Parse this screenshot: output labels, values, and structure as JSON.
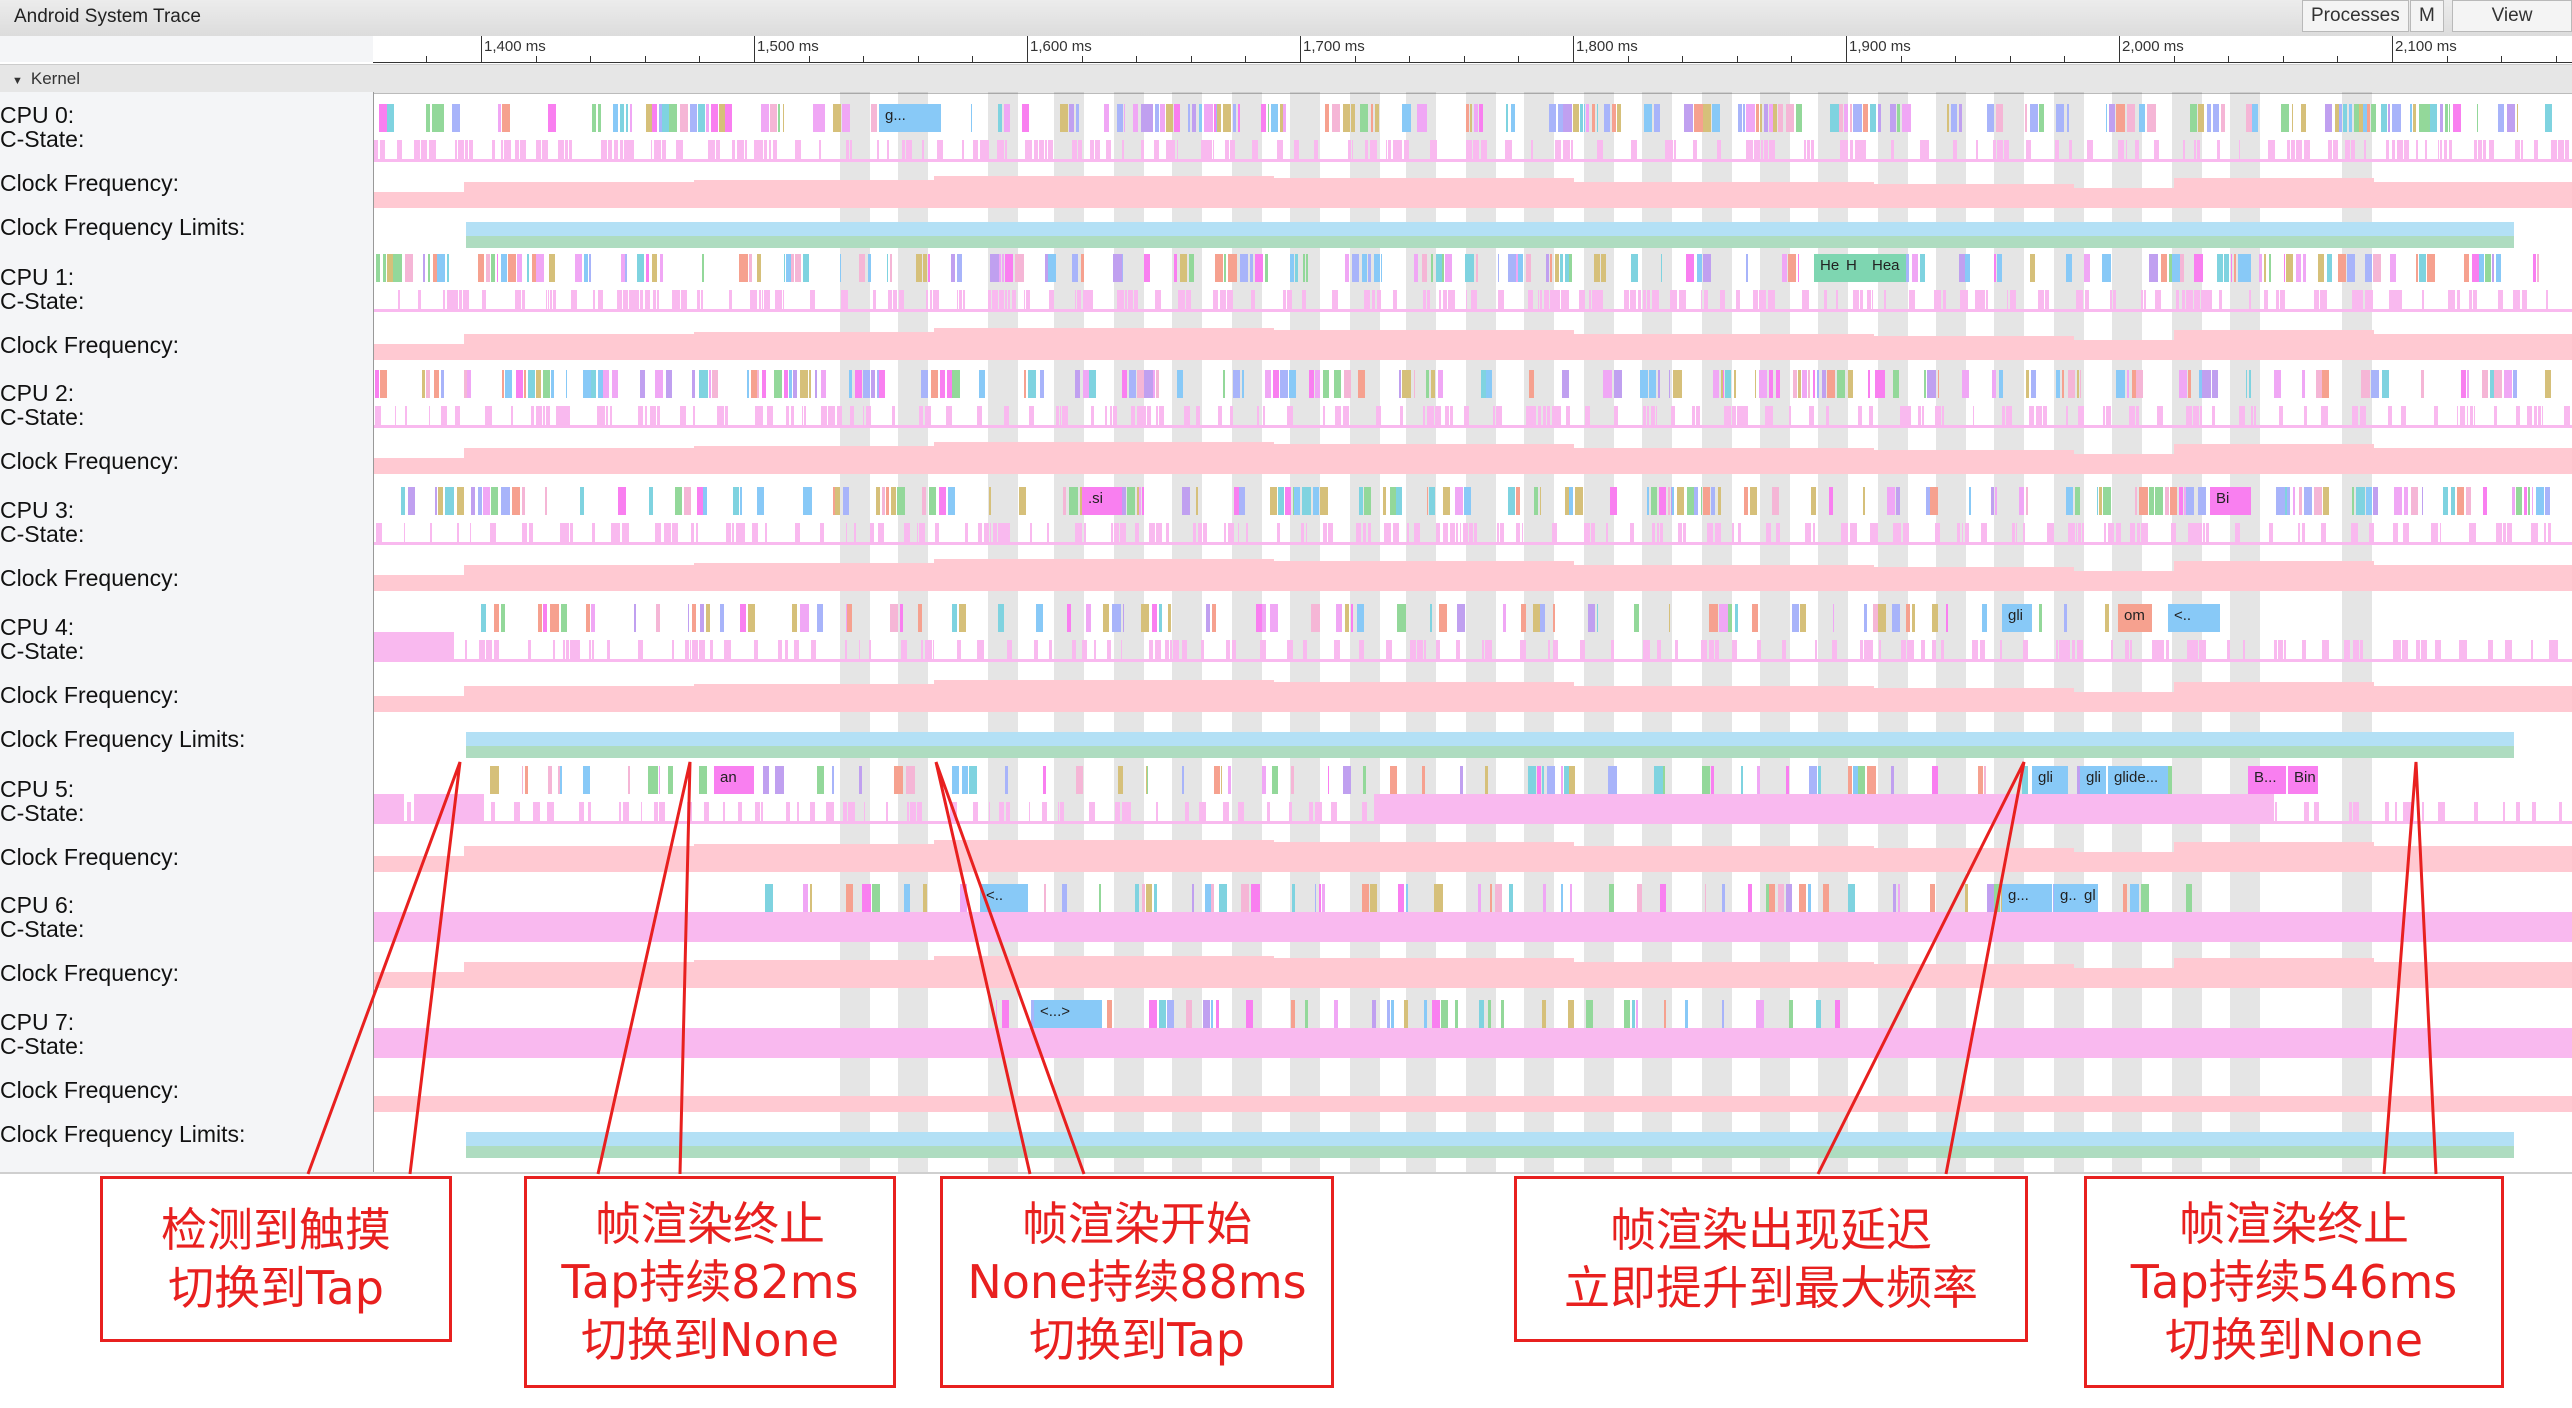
{
  "window": {
    "title": "Android System Trace",
    "buttons": [
      {
        "label": "Processes"
      },
      {
        "label": "M"
      },
      {
        "label": "View Options"
      }
    ]
  },
  "ruler": {
    "unit": "ms",
    "major_ticks": [
      "1,400 ms",
      "1,500 ms",
      "1,600 ms",
      "1,700 ms",
      "1,800 ms",
      "1,900 ms",
      "2,000 ms",
      "2,100 ms"
    ]
  },
  "group": {
    "label": "Kernel",
    "expand_icon": "triangle-down-icon"
  },
  "tracks": {
    "labels": [
      "CPU 0:",
      "C-State:",
      "Clock Frequency:",
      "Clock Frequency Limits:",
      "CPU 1:",
      "C-State:",
      "Clock Frequency:",
      "CPU 2:",
      "C-State:",
      "Clock Frequency:",
      "CPU 3:",
      "C-State:",
      "Clock Frequency:",
      "CPU 4:",
      "C-State:",
      "Clock Frequency:",
      "Clock Frequency Limits:",
      "CPU 5:",
      "C-State:",
      "Clock Frequency:",
      "CPU 6:",
      "C-State:",
      "Clock Frequency:",
      "CPU 7:",
      "C-State:",
      "Clock Frequency:",
      "Clock Frequency Limits:"
    ]
  },
  "slice_labels": {
    "cpu0": [
      "g..."
    ],
    "cpu1": [
      "He",
      "H",
      "Hea"
    ],
    "cpu3": [
      ".si",
      "Bi"
    ],
    "cpu4": [
      "gli",
      "om",
      "<.."
    ],
    "cpu5": [
      "an",
      "gli",
      "gli",
      "glide...",
      "B...",
      "Bin"
    ],
    "cpu6": [
      "<..",
      "g...",
      "g...",
      "gl"
    ],
    "cpu7": [
      "<...>"
    ]
  },
  "colors": {
    "annotation": "#e8201f",
    "cstate": "#f9b9ef",
    "clock_frequency": "#ffc9d2",
    "limit_max": "#b3e0f5",
    "limit_min": "#aedcc0"
  },
  "annotations": [
    {
      "lines": [
        "检测到触摸",
        "切换到Tap"
      ]
    },
    {
      "lines": [
        "帧渲染终止",
        "Tap持续82ms",
        "切换到None"
      ]
    },
    {
      "lines": [
        "帧渲染开始",
        "None持续88ms",
        "切换到Tap"
      ]
    },
    {
      "lines": [
        "帧渲染出现延迟",
        "立即提升到最大频率"
      ]
    },
    {
      "lines": [
        "帧渲染终止",
        "Tap持续546ms",
        "切换到None"
      ]
    }
  ]
}
